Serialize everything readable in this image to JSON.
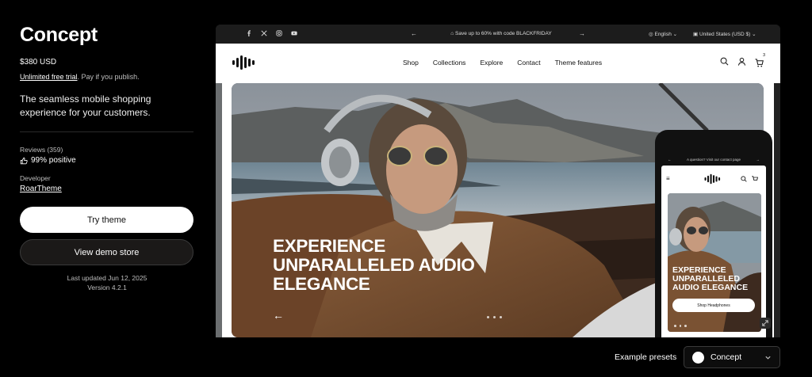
{
  "theme": {
    "title": "Concept",
    "price": "$380 USD",
    "trial_link": "Unlimited free trial",
    "trial_suffix": ". Pay if you publish.",
    "tagline": "The seamless mobile shopping experience for your customers.",
    "reviews_label": "Reviews (359)",
    "positive": "99% positive",
    "developer_label": "Developer",
    "developer_name": "RoarTheme",
    "try_label": "Try theme",
    "demo_label": "View demo store",
    "last_updated": "Last updated Jun 12, 2025",
    "version": "Version 4.2.1"
  },
  "preview": {
    "announcement": "Save up to 60% with code BLACKFRIDAY",
    "language": "English",
    "country": "United States (USD $)",
    "nav": [
      "Shop",
      "Collections",
      "Explore",
      "Contact",
      "Theme features"
    ],
    "cart_count": "3",
    "hero_title_lines": [
      "EXPERIENCE",
      "UNPARALLELED AUDIO",
      "ELEGANCE"
    ],
    "slide_arrow": "←"
  },
  "mobile_preview": {
    "announcement": "A question? Visit our contact page",
    "hero_title_lines": [
      "EXPERIENCE",
      "UNPARALLELED",
      "AUDIO ELEGANCE"
    ],
    "cta": "Shop Headphones"
  },
  "presets": {
    "label": "Example presets",
    "selected": "Concept"
  },
  "colors": {
    "background": "#000000",
    "primary_button": "#ffffff",
    "secondary_button": "#1b1918",
    "muted_text": "#bdbdbd"
  }
}
